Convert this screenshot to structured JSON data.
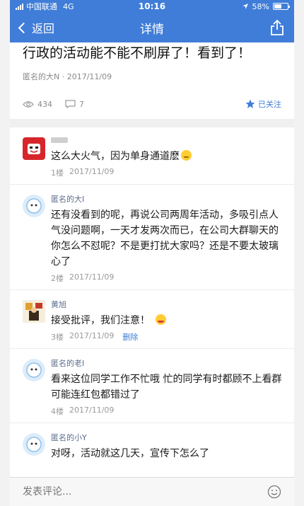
{
  "status": {
    "carrier": "中国联通",
    "network": "4G",
    "time": "10:16",
    "battery": "58%",
    "battery_level": 0.58
  },
  "nav": {
    "back_label": "返回",
    "title": "详情"
  },
  "post": {
    "title": "行政的活动能不能不刷屏了！看到了！",
    "author": "匿名的大N · 2017/11/09",
    "views": "434",
    "comments": "7",
    "follow_label": "已关注"
  },
  "comments": [
    {
      "name": "",
      "text": "这么大火气，因为单身通道麽",
      "floor": "1楼",
      "date": "2017/11/09"
    },
    {
      "name": "匿名的大I",
      "text": "还有没看到的呢，再说公司两周年活动，多吸引点人气没问题啊，一天才发两次而已，在公司大群聊天的你怎么不怼呢？不是更打扰大家吗？还是不要太玻璃心了",
      "floor": "2楼",
      "date": "2017/11/09"
    },
    {
      "name": "黄旭",
      "text": "接受批评，我们注意！",
      "floor": "3楼",
      "date": "2017/11/09",
      "delete_label": "删除"
    },
    {
      "name": "匿名的老I",
      "text": "看来这位同学工作不忙哦 忙的同学有时都顾不上看群 可能连红包都错过了",
      "floor": "4楼",
      "date": "2017/11/09"
    },
    {
      "name": "匿名的小Y",
      "text": "对呀，活动就这几天，宣传下怎么了"
    }
  ],
  "bottom": {
    "placeholder": "发表评论..."
  },
  "colors": {
    "brand": "#3f7dd8",
    "meta": "#8a8a8a"
  }
}
